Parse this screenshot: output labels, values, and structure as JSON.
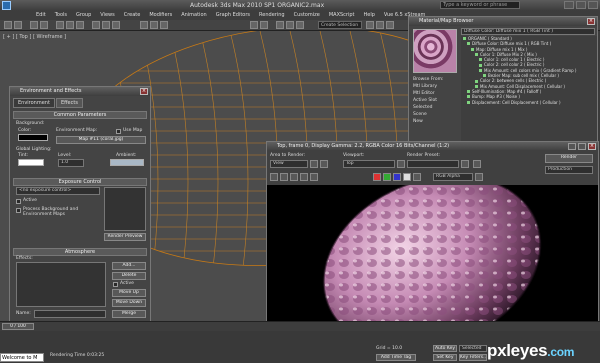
{
  "titlebar": {
    "title": "Autodesk 3ds Max 2010 SP1    ORGANIC2.max",
    "search_placeholder": "Type a keyword or phrase"
  },
  "menubar": [
    "Edit",
    "Tools",
    "Group",
    "Views",
    "Create",
    "Modifiers",
    "Animation",
    "Graph Editors",
    "Rendering",
    "Customize",
    "MAXScript",
    "Help",
    "Vue 6.5 xStream"
  ],
  "toolbar": {
    "selection_set": "Create Selection"
  },
  "viewport": {
    "label": "[ + ] [ Top ] [ Wireframe ]"
  },
  "environment": {
    "title": "Environment and Effects",
    "tabs": [
      "Environment",
      "Effects"
    ],
    "common": {
      "header": "Common Parameters",
      "background_label": "Background:",
      "color_label": "Color:",
      "env_map_label": "Environment Map:",
      "use_map_label": "Use Map",
      "map_name": "Map #11 (coral.jpg)",
      "global_lighting": "Global Lighting:",
      "tint_label": "Tint:",
      "level_label": "Level:",
      "level_value": "1.0",
      "ambient_label": "Ambient:"
    },
    "exposure": {
      "header": "Exposure Control",
      "selected": "<no exposure control>",
      "active_label": "Active",
      "process_label": "Process Background and Environment Maps",
      "render_preview": "Render Preview"
    },
    "atmosphere": {
      "header": "Atmosphere",
      "effects_label": "Effects:",
      "add": "Add...",
      "delete": "Delete",
      "active": "Active",
      "move_up": "Move Up",
      "move_down": "Move Down",
      "name_label": "Name:",
      "merge": "Merge"
    }
  },
  "material_browser": {
    "title": "Material/Map Browser",
    "field_value": "Diffuse Color: Diffuse mix 1  ( RGB Tint )",
    "browse_from_label": "Browse From:",
    "browse_options": [
      "Mtl Library",
      "Mtl Editor",
      "Active Slot",
      "Selected",
      "Scene",
      "New"
    ],
    "tree": [
      "ORGANIC  ( Standard )",
      "Diffuse Color: Diffuse mix 1  ( RGB Tint )",
      "Map: Diffuse mix 1  ( Mix )",
      "Color 1: Diffuse Mix 2  ( Mix )",
      "Color 1: cell color 1  ( Electric )",
      "Color 2: cell color 2  ( Electric )",
      "Mix Amount: cell colors mix  ( Gradient Ramp )",
      "Bezier Map: sub cell mix  ( Cellular )",
      "Color 2: between cells  ( Electric )",
      "Mix Amount: Cell Displacement  ( Cellular )",
      "Self-Illumination: Map #4  ( Falloff )",
      "Bump: Map #3  ( Noise )",
      "Displacement: Cell Displacement  ( Cellular )"
    ]
  },
  "render_window": {
    "title": "Top, frame 0, Display Gamma: 2.2, RGBA Color 16 Bits/Channel (1:2)",
    "area_to_render_label": "Area to Render:",
    "area_to_render": "View",
    "viewport_label": "Viewport:",
    "viewport": "Top",
    "render_preset_label": "Render Preset:",
    "render_button": "Render",
    "production": "Production",
    "channel": "RGB Alpha"
  },
  "status": {
    "welcome": "Welcome to M",
    "rendering_time": "Rendering Time  0:03:25",
    "grid": "Grid = 10.0",
    "add_time_tag": "Add Time Tag",
    "auto_key": "Auto Key",
    "selected": "Selected",
    "set_key": "Set Key",
    "key_filters": "Key Filters..."
  },
  "timeline": {
    "frames": "0 / 100"
  },
  "watermark": {
    "text_main": "pxleyes",
    "text_dom": ".com"
  },
  "colors": {
    "wire": "#d98a1e",
    "accent": "#6bd3ff"
  }
}
